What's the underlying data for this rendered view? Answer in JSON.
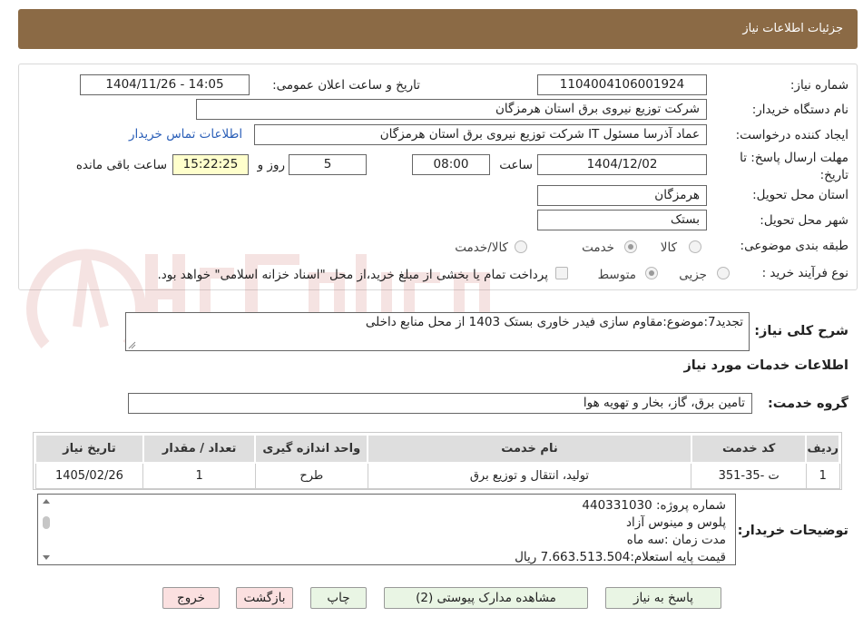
{
  "header": {
    "title": "جزئیات اطلاعات نیاز"
  },
  "labels": {
    "need_number": "شماره نیاز:",
    "announce_datetime": "تاریخ و ساعت اعلان عمومی:",
    "buyer_org": "نام دستگاه خریدار:",
    "requester": "ایجاد کننده درخواست:",
    "deadline": "مهلت ارسال پاسخ: تا تاریخ:",
    "time_word": "ساعت",
    "days_word": "روز و",
    "remaining_word": "ساعت باقی مانده",
    "province": "استان محل تحویل:",
    "city": "شهر محل تحویل:",
    "category": "طبقه بندی موضوعی:",
    "process_type": "نوع فرآیند خرید :",
    "general_desc": "شرح کلی نیاز:",
    "services_heading": "اطلاعات خدمات مورد نیاز",
    "service_group": "گروه خدمت:",
    "buyer_notes": "توضیحات خریدار:"
  },
  "values": {
    "need_number": "1104004106001924",
    "announce_datetime": "1404/11/26 - 14:05",
    "buyer_org": "شرکت توزیع نیروی برق استان هرمزگان",
    "requester": "عماد آذرسا مسئول IT شرکت توزیع نیروی برق استان هرمزگان",
    "contact_link": "اطلاعات تماس خریدار",
    "deadline_date": "1404/12/02",
    "deadline_time": "08:00",
    "days": "5",
    "remaining_time": "15:22:25",
    "province": "هرمزگان",
    "city": "بستک",
    "general_desc": "تجدید7:موضوع:مقاوم سازی فیدر خاوری  بستک 1403 از محل منابع داخلی",
    "service_group": "تامین برق، گاز، بخار و تهویه هوا"
  },
  "category_options": [
    {
      "label": "کالا",
      "selected": false
    },
    {
      "label": "خدمت",
      "selected": true
    },
    {
      "label": "کالا/خدمت",
      "selected": false
    }
  ],
  "process_options": [
    {
      "label": "جزیی",
      "selected": false
    },
    {
      "label": "متوسط",
      "selected": true
    }
  ],
  "payment_note": "پرداخت تمام یا بخشی از مبلغ خرید،از محل \"اسناد خزانه اسلامی\" خواهد بود.",
  "table": {
    "headers": [
      "ردیف",
      "کد خدمت",
      "نام خدمت",
      "واحد اندازه گیری",
      "تعداد / مقدار",
      "تاریخ نیاز"
    ],
    "rows": [
      [
        "1",
        "ت -35-351",
        "تولید، انتقال و توزیع برق",
        "طرح",
        "1",
        "1405/02/26"
      ]
    ]
  },
  "buyer_notes_lines": [
    "شماره پروژه:  440331030",
    " پلوس و مینوس آزاد",
    "مدت زمان :سه ماه",
    "قیمت پایه استعلام:7.663.513.504 ریال"
  ],
  "buttons": {
    "reply": "پاسخ به نیاز",
    "attachments": "مشاهده مدارک پیوستی (2)",
    "print": "چاپ",
    "back": "بازگشت",
    "exit": "خروج"
  },
  "colors": {
    "header_bg": "#8b6a45",
    "button_green": "#e9f5e4",
    "button_red": "#fbe0e0",
    "highlight_yellow": "#ffffcc",
    "link": "#2b5fb8",
    "watermark": "#b8332b"
  }
}
